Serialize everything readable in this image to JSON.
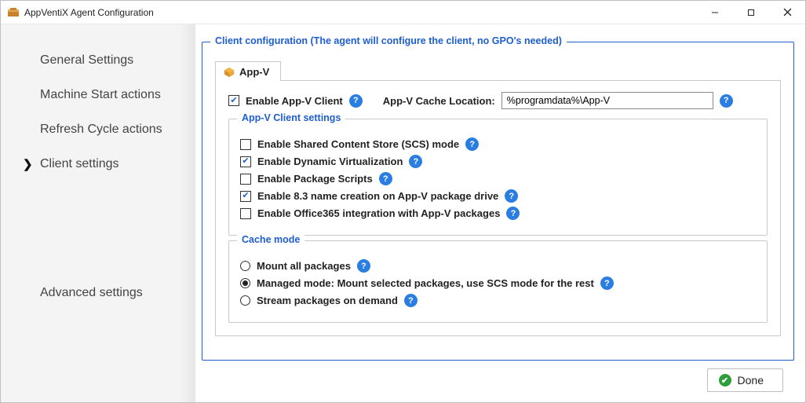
{
  "window": {
    "title": "AppVentiX Agent Configuration"
  },
  "sidebar": {
    "items": [
      {
        "label": "General Settings"
      },
      {
        "label": "Machine Start actions"
      },
      {
        "label": "Refresh Cycle actions"
      },
      {
        "label": "Client settings"
      },
      {
        "label": "Advanced settings"
      }
    ],
    "selected_index": 3
  },
  "main": {
    "group_title": "Client configuration (The agent will configure the client, no GPO's needed)",
    "tab": {
      "label": "App-V"
    },
    "enable_client": {
      "label": "Enable App-V Client",
      "checked": true
    },
    "cache_location": {
      "label": "App-V Cache Location:",
      "value": "%programdata%\\App-V"
    },
    "client_settings": {
      "title": "App-V Client settings",
      "opts": [
        {
          "label": "Enable Shared Content Store (SCS) mode",
          "checked": false
        },
        {
          "label": "Enable Dynamic Virtualization",
          "checked": true
        },
        {
          "label": "Enable Package Scripts",
          "checked": false
        },
        {
          "label": "Enable 8.3 name creation on App-V package drive",
          "checked": true
        },
        {
          "label": "Enable Office365 integration with App-V packages",
          "checked": false
        }
      ]
    },
    "cache_mode": {
      "title": "Cache mode",
      "opts": [
        {
          "label": "Mount all packages",
          "selected": false
        },
        {
          "label": "Managed mode: Mount selected packages, use SCS mode for the rest",
          "selected": true
        },
        {
          "label": "Stream packages on demand",
          "selected": false
        }
      ]
    }
  },
  "footer": {
    "done_label": "Done"
  }
}
